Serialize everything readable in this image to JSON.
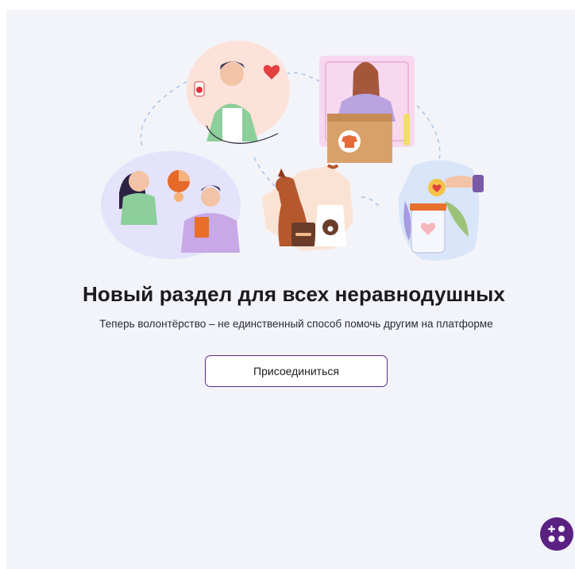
{
  "hero": {
    "title": "Новый раздел для всех неравнодушных",
    "subtitle": "Теперь волонтёрство – не единственный способ помочь другим на платформе",
    "join_button_label": "Присоединиться"
  },
  "illustration": {
    "scenes": [
      "blood-donation",
      "clothes-box",
      "learning-together",
      "pet-food-dog",
      "donation-jar"
    ]
  },
  "fab": {
    "icon": "plus-dots-icon"
  },
  "colors": {
    "background": "#f2f4f9",
    "accent": "#5a2182",
    "button_border": "#5a2a82",
    "title": "#1b1b1f"
  }
}
